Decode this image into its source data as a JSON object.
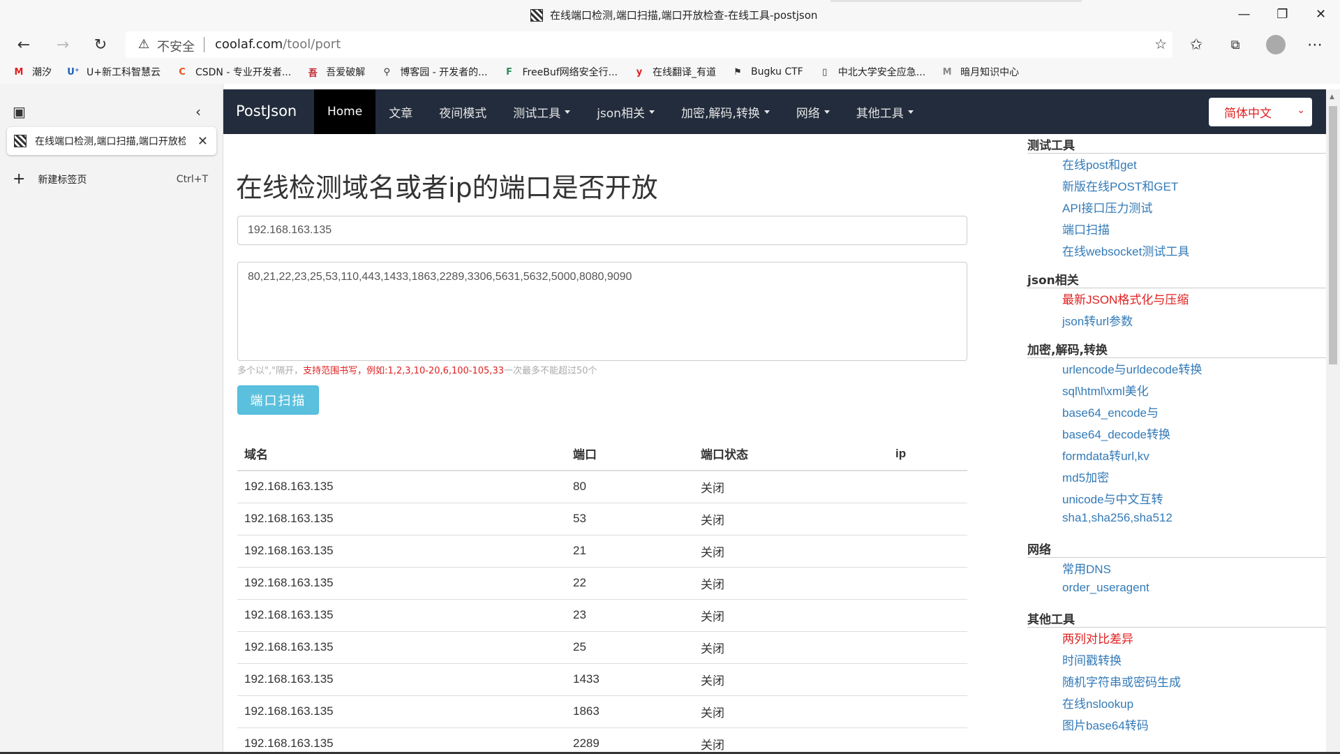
{
  "window": {
    "title": "在线端口检测,端口扫描,端口开放检查-在线工具-postjson"
  },
  "toolbar": {
    "insecure_label": "不安全",
    "url_host": "coolaf.com",
    "url_path": "/tool/port"
  },
  "bookmarks": [
    {
      "icon": "M",
      "label": "潮汐",
      "color": "#e02020"
    },
    {
      "icon": "U⁺",
      "label": "U+新工科智慧云",
      "color": "#1a5fb4"
    },
    {
      "icon": "C",
      "label": "CSDN - 专业开发者...",
      "color": "#e8501a"
    },
    {
      "icon": "吾",
      "label": "吾爱破解",
      "color": "#c01c28"
    },
    {
      "icon": "⚲",
      "label": "博客园 - 开发者的...",
      "color": "#333333"
    },
    {
      "icon": "F",
      "label": "FreeBuf网络安全行...",
      "color": "#2e8b57"
    },
    {
      "icon": "y",
      "label": "在线翻译_有道",
      "color": "#e02020"
    },
    {
      "icon": "⚑",
      "label": "Bugku CTF",
      "color": "#333333"
    },
    {
      "icon": "▯",
      "label": "中北大学安全应急...",
      "color": "#333333"
    },
    {
      "icon": "M",
      "label": "暗月知识中心",
      "color": "#888888"
    }
  ],
  "sidepanel": {
    "tab_label": "在线端口检测,端口扫描,端口开放检查-在线工具-postjson",
    "new_tab_label": "新建标签页",
    "new_tab_shortcut": "Ctrl+T"
  },
  "navbar": {
    "brand": "PostJson",
    "items": [
      {
        "label": "Home",
        "dropdown": false,
        "active": true
      },
      {
        "label": "文章",
        "dropdown": false,
        "active": false
      },
      {
        "label": "夜间模式",
        "dropdown": false,
        "active": false
      },
      {
        "label": "测试工具",
        "dropdown": true,
        "active": false
      },
      {
        "label": "json相关",
        "dropdown": true,
        "active": false
      },
      {
        "label": "加密,解码,转换",
        "dropdown": true,
        "active": false
      },
      {
        "label": "网络",
        "dropdown": true,
        "active": false
      },
      {
        "label": "其他工具",
        "dropdown": true,
        "active": false
      }
    ],
    "language": "简体中文"
  },
  "main": {
    "heading": "在线检测域名或者ip的端口是否开放",
    "host_value": "192.168.163.135",
    "ports_value": "80,21,22,23,25,53,110,443,1433,1863,2289,3306,5631,5632,5000,8080,9090",
    "hint_gray1": "多个以\",\"隔开，",
    "hint_red": "支持范围书写，例如:1,2,3,10-20,6,100-105,33",
    "hint_gray2": "一次最多不能超过50个",
    "scan_button": "端口扫描",
    "table": {
      "headers": [
        "域名",
        "端口",
        "端口状态",
        "ip"
      ],
      "rows": [
        [
          "192.168.163.135",
          "80",
          "关闭",
          ""
        ],
        [
          "192.168.163.135",
          "53",
          "关闭",
          ""
        ],
        [
          "192.168.163.135",
          "21",
          "关闭",
          ""
        ],
        [
          "192.168.163.135",
          "22",
          "关闭",
          ""
        ],
        [
          "192.168.163.135",
          "23",
          "关闭",
          ""
        ],
        [
          "192.168.163.135",
          "25",
          "关闭",
          ""
        ],
        [
          "192.168.163.135",
          "1433",
          "关闭",
          ""
        ],
        [
          "192.168.163.135",
          "1863",
          "关闭",
          ""
        ],
        [
          "192.168.163.135",
          "2289",
          "关闭",
          ""
        ]
      ]
    }
  },
  "sidebar": {
    "sections": [
      {
        "title": "测试工具",
        "links": [
          {
            "label": "在线post和get",
            "red": false
          },
          {
            "label": "新版在线POST和GET",
            "red": false
          },
          {
            "label": "API接口压力测试",
            "red": false
          },
          {
            "label": "端口扫描",
            "red": false
          },
          {
            "label": "在线websocket测试工具",
            "red": false
          }
        ]
      },
      {
        "title": "json相关",
        "links": [
          {
            "label": "最新JSON格式化与压缩",
            "red": true
          },
          {
            "label": "json转url参数",
            "red": false
          }
        ]
      },
      {
        "title": "加密,解码,转换",
        "links": [
          {
            "label": "urlencode与urldecode转换",
            "red": false
          },
          {
            "label": "sql\\html\\xml美化",
            "red": false
          },
          {
            "label": "base64_encode与",
            "red": false
          },
          {
            "label": "base64_decode转换",
            "red": false
          },
          {
            "label": "formdata转url,kv",
            "red": false
          },
          {
            "label": "md5加密",
            "red": false
          },
          {
            "label": "unicode与中文互转",
            "red": false
          },
          {
            "label": "sha1,sha256,sha512",
            "red": false
          }
        ]
      },
      {
        "title": "网络",
        "links": [
          {
            "label": "常用DNS",
            "red": false
          },
          {
            "label": "order_useragent",
            "red": false
          }
        ]
      },
      {
        "title": "其他工具",
        "links": [
          {
            "label": "两列对比差异",
            "red": true
          },
          {
            "label": "时间戳转换",
            "red": false
          },
          {
            "label": "随机字符串或密码生成",
            "red": false
          },
          {
            "label": "在线nslookup",
            "red": false
          },
          {
            "label": "图片base64转码",
            "red": false
          }
        ]
      }
    ]
  }
}
